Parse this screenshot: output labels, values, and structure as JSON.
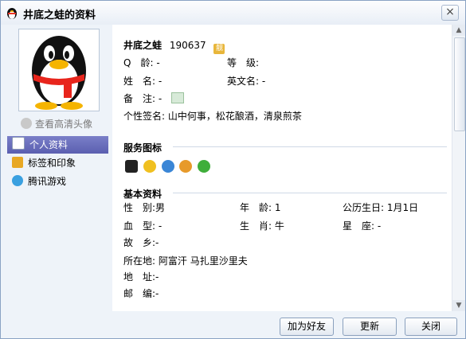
{
  "window": {
    "title": "井底之蛙的资料",
    "close_glyph": "×"
  },
  "sidebar": {
    "view_hd_avatar": "查看高清头像",
    "nav": [
      {
        "label": "个人资料",
        "icon": "profile-card-icon",
        "active": true
      },
      {
        "label": "标签和印象",
        "icon": "tag-icon",
        "active": false
      },
      {
        "label": "腾讯游戏",
        "icon": "games-icon",
        "active": false
      }
    ]
  },
  "profile": {
    "nickname": "井底之蛙",
    "qq_number": "190637",
    "badge": "靓",
    "fields": {
      "qq_age_label": "Q　龄:",
      "qq_age_value": "-",
      "level_label": "等　级:",
      "level_value": "",
      "name_label": "姓　名:",
      "name_value": "-",
      "english_name_label": "英文名:",
      "english_name_value": "-",
      "remark_label": "备　注:",
      "remark_value": "-",
      "signature_label": "个性签名:",
      "signature_value": "山中何事，松花酿酒，清泉煎茶"
    }
  },
  "service_icons": {
    "title": "服务图标",
    "icons": [
      "qq-penguin-icon",
      "smiley-icon",
      "shield-icon",
      "horn-icon",
      "green-arrow-icon"
    ]
  },
  "basic_info": {
    "title": "基本资料",
    "rows": [
      [
        "性　别:",
        "男",
        "年　龄:",
        "1",
        "公历生日:",
        "1月1日"
      ],
      [
        "血　型:",
        "-",
        "生　肖:",
        "牛",
        "星　座:",
        "-"
      ]
    ],
    "hometown_label": "故　乡:",
    "hometown_value": "-",
    "location_label": "所在地:",
    "location_value": "阿富汗 马扎里沙里夫",
    "address_label": "地　址:",
    "address_value": "-",
    "postcode_label": "邮　编:",
    "postcode_value": "-"
  },
  "buttons": {
    "add_friend": "加为好友",
    "refresh": "更新",
    "close": "关闭"
  },
  "colors": {
    "nav_active": "#5b5fb0",
    "window_bg": "#eef3f9",
    "border": "#8aa3c4"
  }
}
